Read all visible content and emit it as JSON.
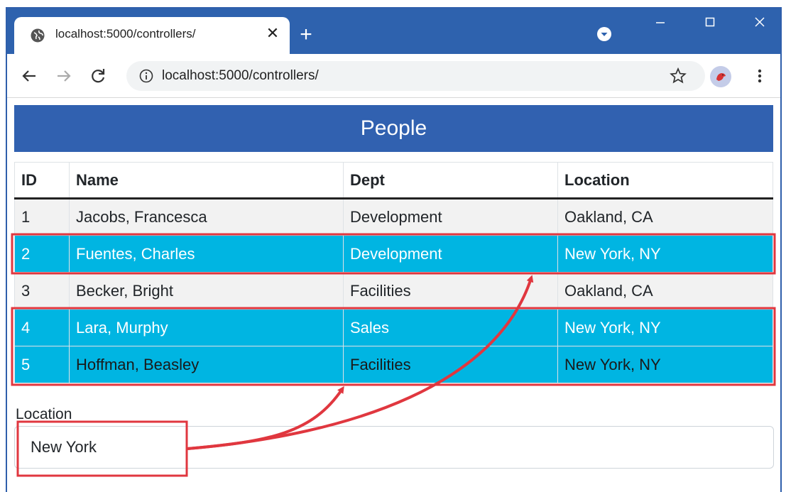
{
  "browser": {
    "tab_title": "localhost:5000/controllers/",
    "tab_close": "✕",
    "new_tab": "+",
    "address_url": "localhost:5000/controllers/"
  },
  "page": {
    "title": "People",
    "table": {
      "headers": [
        "ID",
        "Name",
        "Dept",
        "Location"
      ],
      "rows": [
        {
          "id": "1",
          "name": "Jacobs, Francesca",
          "dept": "Development",
          "location": "Oakland, CA",
          "highlighted": false
        },
        {
          "id": "2",
          "name": "Fuentes, Charles",
          "dept": "Development",
          "location": "New York, NY",
          "highlighted": true
        },
        {
          "id": "3",
          "name": "Becker, Bright",
          "dept": "Facilities",
          "location": "Oakland, CA",
          "highlighted": false
        },
        {
          "id": "4",
          "name": "Lara, Murphy",
          "dept": "Sales",
          "location": "New York, NY",
          "highlighted": true
        },
        {
          "id": "5",
          "name": "Hoffman, Beasley",
          "dept": "Facilities",
          "location": "New York, NY",
          "highlighted": true
        }
      ]
    },
    "filter": {
      "label": "Location",
      "value": "New York"
    }
  },
  "colors": {
    "titlebar": "#2e62ae",
    "header": "#3161b0",
    "highlight_row": "#00b5e2",
    "annotation": "#e0373f"
  }
}
